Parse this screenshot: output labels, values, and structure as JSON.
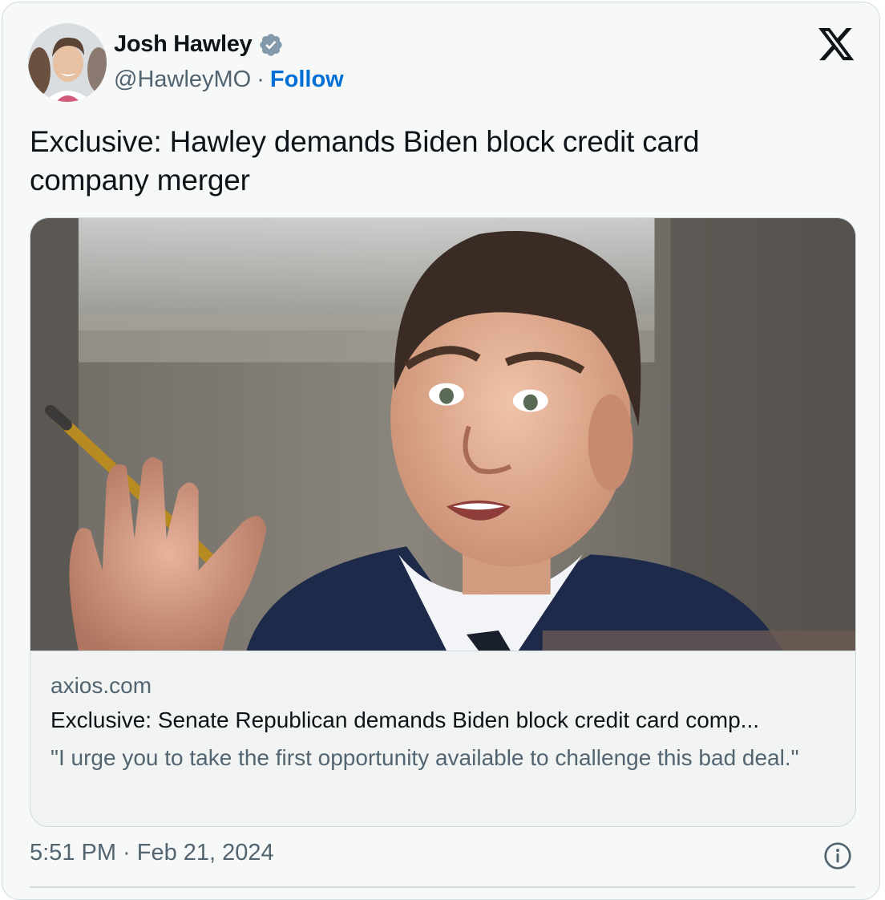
{
  "author": {
    "name": "Josh Hawley",
    "handle": "@HawleyMO",
    "separator": "·",
    "follow_label": "Follow",
    "verified_icon": "verified-badge-icon"
  },
  "tweet": {
    "text": "Exclusive: Hawley demands Biden block credit card company merger"
  },
  "card": {
    "domain": "axios.com",
    "title": "Exclusive: Senate Republican demands Biden block credit card comp...",
    "description": "\"I urge you to take the first opportunity available to challenge this bad deal.\""
  },
  "footer": {
    "timestamp": "5:51 PM · Feb 21, 2024",
    "info_icon": "info-icon"
  },
  "colors": {
    "background": "#f7f9f9",
    "border": "#cfd9de",
    "text_primary": "#0f1419",
    "text_secondary": "#536471",
    "link": "#006fd6",
    "verified": "#829aab"
  },
  "logo": "x-logo-icon"
}
